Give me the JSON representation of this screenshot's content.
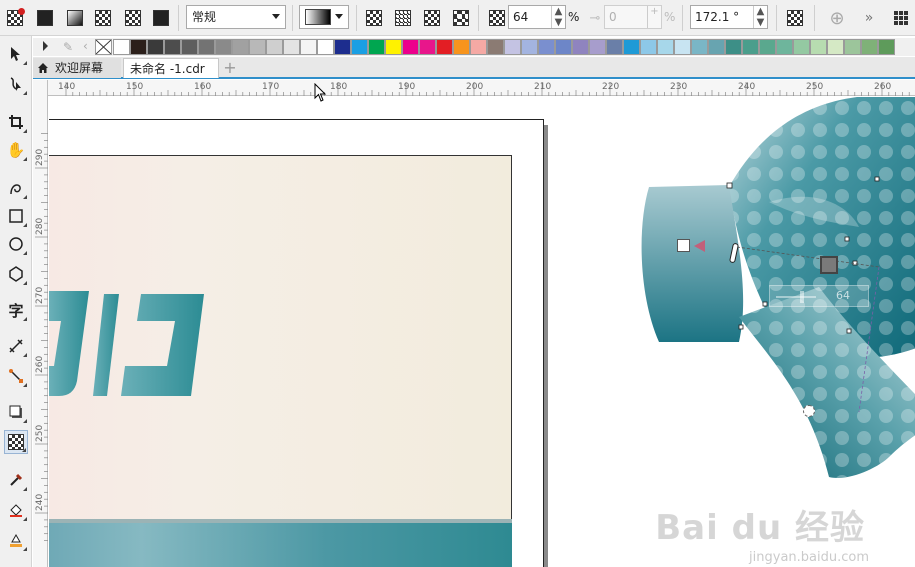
{
  "propbar": {
    "merge_mode": "常规",
    "transparency_value": "64",
    "percent_sign": "%",
    "disabled_value": "0",
    "disabled_percent": "%",
    "angle_value": "172.1 °"
  },
  "tabs": {
    "welcome": "欢迎屏幕",
    "document": "未命名 -1.cdr"
  },
  "ruler": {
    "h_ticks": [
      "140",
      "150",
      "160",
      "170",
      "180",
      "190",
      "200",
      "210",
      "220",
      "230",
      "240",
      "250",
      "260"
    ],
    "v_ticks": [
      "290",
      "280",
      "270",
      "260",
      "250",
      "240"
    ]
  },
  "canvas": {
    "slider_value": "64",
    "design_text": "JD"
  },
  "watermark": {
    "main": "Bai du 经验",
    "sub": "jingyan.baidu.com"
  },
  "palette": [
    "#ffffff",
    "#2b1f1a",
    "#3a3a3a",
    "#4d4d4d",
    "#5e5e5e",
    "#737373",
    "#8a8a8a",
    "#a1a1a1",
    "#b8b8b8",
    "#cfcfcf",
    "#e3e3e3",
    "#f4f4f4",
    "#ffffff",
    "#1d2d8e",
    "#1a9fe3",
    "#00a650",
    "#fff200",
    "#ec008c",
    "#e8168b",
    "#e31e24",
    "#f7941d",
    "#f5a9a4",
    "#8b7b73",
    "#c4c3e3",
    "#a3b4e0",
    "#7a8fcf",
    "#6d86c8",
    "#8f84bf",
    "#a79dcc",
    "#6a7fa8",
    "#1e9ad6",
    "#8dc8e8",
    "#a7d7ea",
    "#c8e4f2",
    "#7ab6c6",
    "#68a4b0",
    "#3d8f87",
    "#4b9e8c",
    "#5aa88e",
    "#6eb59c",
    "#94c9a2",
    "#b7dcb0",
    "#d5e9c5",
    "#9cc59b",
    "#7fb178",
    "#5e9b5b"
  ]
}
